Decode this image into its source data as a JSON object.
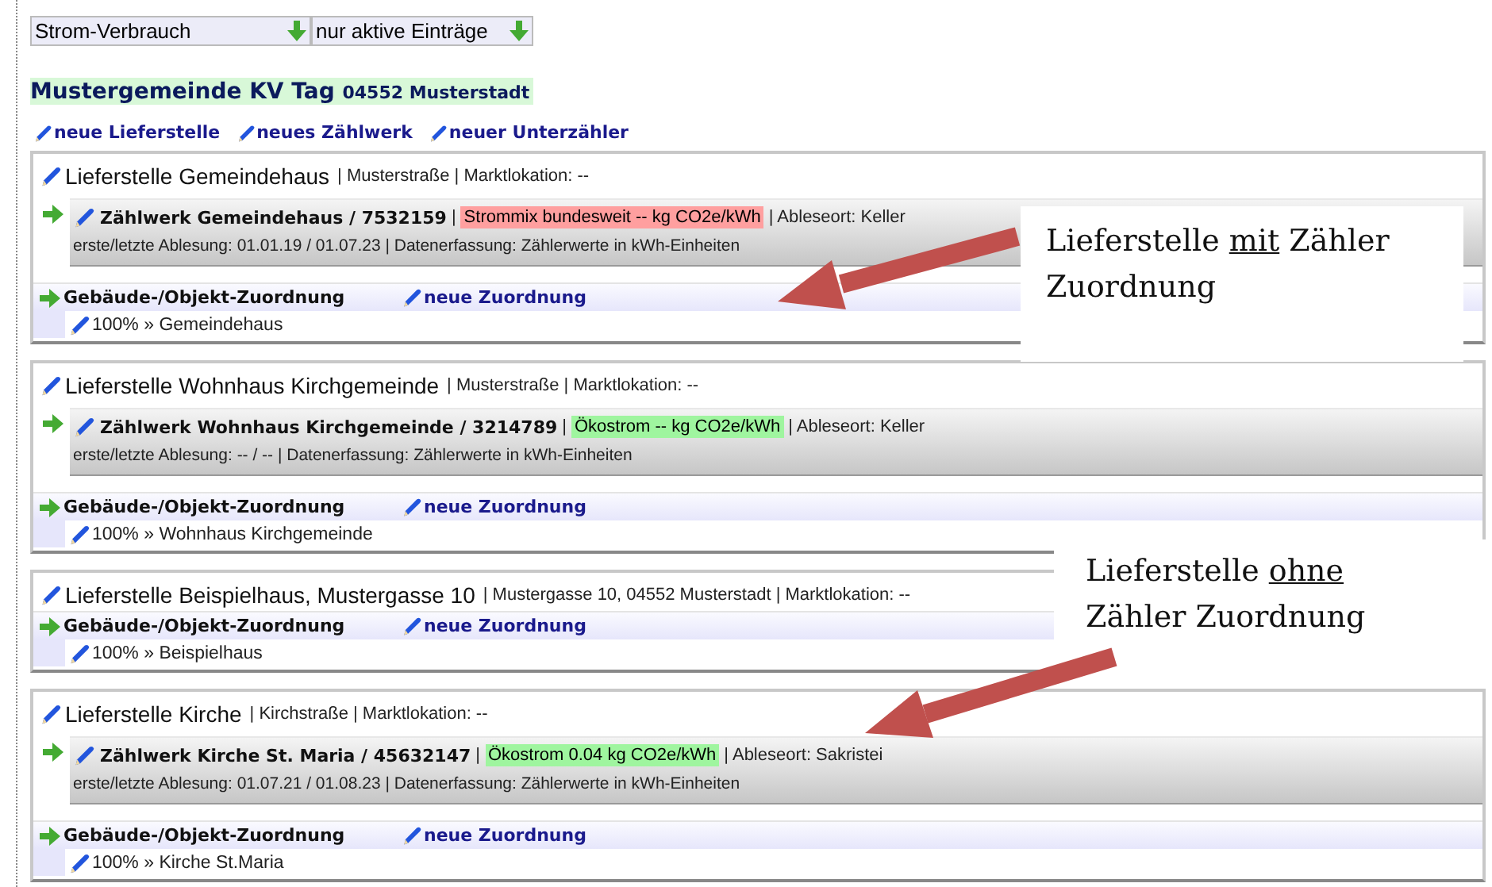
{
  "filters": [
    {
      "label": "Strom-Verbrauch"
    },
    {
      "label": "nur aktive Einträge"
    }
  ],
  "title": {
    "main": "Mustergemeinde KV Tag",
    "sub": "04552 Musterstadt"
  },
  "links": [
    "neue Lieferstelle",
    "neues Zählwerk",
    "neuer Unterzähler"
  ],
  "delivery_points": [
    {
      "name": "Lieferstelle Gemeindehaus",
      "details": "| Musterstraße | Marktlokation: --",
      "meter": {
        "name": "Zählwerk Gemeindehaus / 7532159",
        "separator": "|",
        "emission": {
          "text": "Strommix bundesweit -- kg CO2e/kWh",
          "color": "#ff9f9f"
        },
        "location": "| Ableseort: Keller",
        "readings": "erste/letzte Ablesung: 01.01.19 / 01.07.23 | Datenerfassung: Zählerwerte in kWh-Einheiten"
      },
      "assignment": {
        "heading": "Gebäude-/Objekt-Zuordnung",
        "link": "neue Zuordnung",
        "items": [
          "100% » Gemeindehaus"
        ]
      }
    },
    {
      "name": "Lieferstelle Wohnhaus Kirchgemeinde",
      "details": "| Musterstraße | Marktlokation: --",
      "meter": {
        "name": "Zählwerk Wohnhaus Kirchgemeinde / 3214789",
        "separator": "|",
        "emission": {
          "text": "Ökostrom -- kg CO2e/kWh",
          "color": "#9ff59f"
        },
        "location": "| Ableseort: Keller",
        "readings": "erste/letzte Ablesung: -- / -- | Datenerfassung: Zählerwerte in kWh-Einheiten"
      },
      "assignment": {
        "heading": "Gebäude-/Objekt-Zuordnung",
        "link": "neue Zuordnung",
        "items": [
          "100% » Wohnhaus Kirchgemeinde"
        ]
      }
    },
    {
      "name": "Lieferstelle Beispielhaus, Mustergasse 10",
      "details": "| Mustergasse 10, 04552 Musterstadt | Marktlokation: --",
      "assignment": {
        "heading": "Gebäude-/Objekt-Zuordnung",
        "link": "neue Zuordnung",
        "items": [
          "100% » Beispielhaus"
        ]
      }
    },
    {
      "name": "Lieferstelle Kirche",
      "details": "| Kirchstraße | Marktlokation: --",
      "meter": {
        "name": "Zählwerk Kirche St. Maria / 45632147",
        "separator": "|",
        "emission": {
          "text": "Ökostrom 0.04 kg CO2e/kWh",
          "color": "#9ff59f"
        },
        "location": "| Ableseort: Sakristei",
        "readings": "erste/letzte Ablesung: 01.07.21 / 01.08.23 | Datenerfassung: Zählerwerte in kWh-Einheiten"
      },
      "assignment": {
        "heading": "Gebäude-/Objekt-Zuordnung",
        "link": "neue Zuordnung",
        "items": [
          "100% » Kirche St.Maria"
        ]
      }
    }
  ],
  "callouts": [
    {
      "parts": [
        {
          "text": "Lieferstelle ",
          "underline": false
        },
        {
          "text": "mit",
          "underline": true
        },
        {
          "text": " Zähler Zuordnung",
          "underline": false
        }
      ]
    },
    {
      "parts": [
        {
          "text": "Lieferstelle ",
          "underline": false
        },
        {
          "text": "ohne",
          "underline": true
        },
        {
          "text": " Zähler Zuordnung",
          "underline": false
        }
      ]
    }
  ]
}
